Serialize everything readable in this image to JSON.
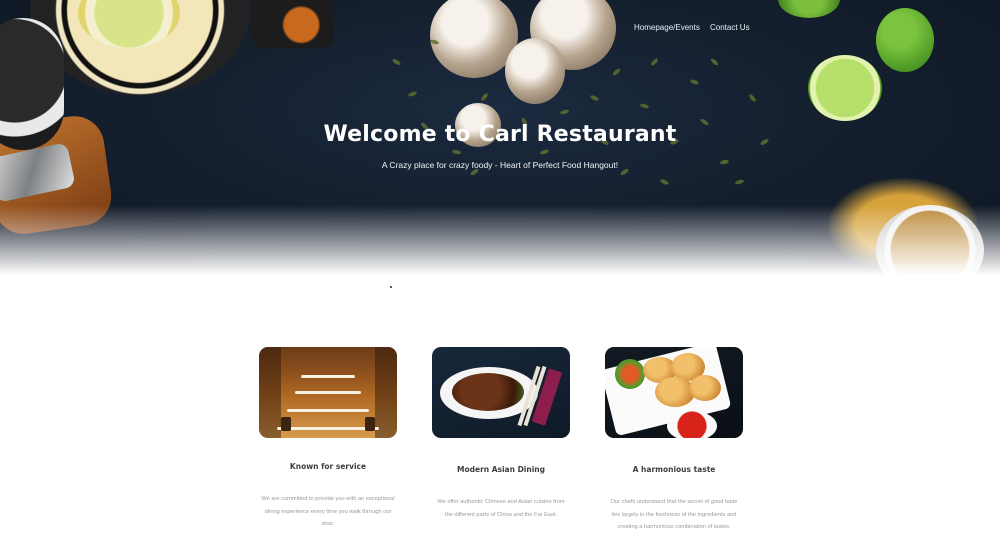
{
  "nav": {
    "links": [
      {
        "label": "Homepage/Events"
      },
      {
        "label": "Contact Us"
      }
    ]
  },
  "hero": {
    "title": "Welcome to Carl Restaurant",
    "subtitle": "A Crazy place for crazy foody - Heart of Perfect Food Hangout!"
  },
  "features": [
    {
      "title": "Known for service",
      "text": "We are committed to provide you with an exceptional dining experience every time you walk through our door."
    },
    {
      "title": "Modern Asian Dining",
      "text": "We offer authentic Chinese and Asian cuisine from the different parts of China and the Far East."
    },
    {
      "title": "A harmonious taste",
      "text": "Our chefs understand that the secret of good taste lies largely in the freshness of the ingredients and creating a harmonious combination of tastes."
    }
  ],
  "colors": {
    "hero_background": "#15202f",
    "heading_text": "#3d3d3d",
    "body_text": "#9a9a9a"
  }
}
